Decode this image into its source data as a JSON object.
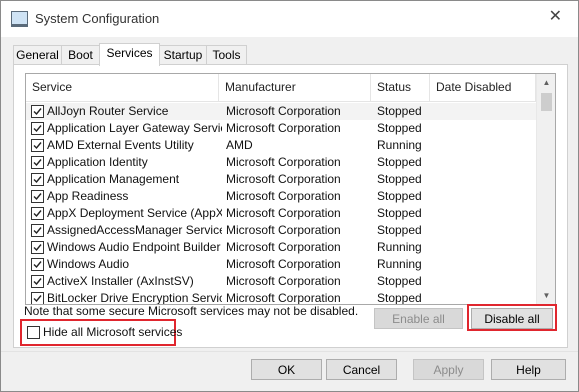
{
  "window": {
    "title": "System Configuration",
    "close_icon": "close-icon"
  },
  "tabs": [
    {
      "label": "General",
      "active": false
    },
    {
      "label": "Boot",
      "active": false
    },
    {
      "label": "Services",
      "active": true
    },
    {
      "label": "Startup",
      "active": false
    },
    {
      "label": "Tools",
      "active": false
    }
  ],
  "columns": [
    "Service",
    "Manufacturer",
    "Status",
    "Date Disabled"
  ],
  "services": [
    {
      "name": "AllJoyn Router Service",
      "manufacturer": "Microsoft Corporation",
      "status": "Stopped",
      "date_disabled": "",
      "checked": true,
      "selected": true
    },
    {
      "name": "Application Layer Gateway Service",
      "manufacturer": "Microsoft Corporation",
      "status": "Stopped",
      "date_disabled": "",
      "checked": true
    },
    {
      "name": "AMD External Events Utility",
      "manufacturer": "AMD",
      "status": "Running",
      "date_disabled": "",
      "checked": true
    },
    {
      "name": "Application Identity",
      "manufacturer": "Microsoft Corporation",
      "status": "Stopped",
      "date_disabled": "",
      "checked": true
    },
    {
      "name": "Application Management",
      "manufacturer": "Microsoft Corporation",
      "status": "Stopped",
      "date_disabled": "",
      "checked": true
    },
    {
      "name": "App Readiness",
      "manufacturer": "Microsoft Corporation",
      "status": "Stopped",
      "date_disabled": "",
      "checked": true
    },
    {
      "name": "AppX Deployment Service (AppX...",
      "manufacturer": "Microsoft Corporation",
      "status": "Stopped",
      "date_disabled": "",
      "checked": true
    },
    {
      "name": "AssignedAccessManager Service",
      "manufacturer": "Microsoft Corporation",
      "status": "Stopped",
      "date_disabled": "",
      "checked": true
    },
    {
      "name": "Windows Audio Endpoint Builder",
      "manufacturer": "Microsoft Corporation",
      "status": "Running",
      "date_disabled": "",
      "checked": true
    },
    {
      "name": "Windows Audio",
      "manufacturer": "Microsoft Corporation",
      "status": "Running",
      "date_disabled": "",
      "checked": true
    },
    {
      "name": "ActiveX Installer (AxInstSV)",
      "manufacturer": "Microsoft Corporation",
      "status": "Stopped",
      "date_disabled": "",
      "checked": true
    },
    {
      "name": "BitLocker Drive Encryption Service",
      "manufacturer": "Microsoft Corporation",
      "status": "Stopped",
      "date_disabled": "",
      "checked": true
    }
  ],
  "note": "Note that some secure Microsoft services may not be disabled.",
  "buttons": {
    "enable_all": "Enable all",
    "disable_all": "Disable all",
    "ok": "OK",
    "cancel": "Cancel",
    "apply": "Apply",
    "help": "Help"
  },
  "hide_ms": {
    "label": "Hide all Microsoft services",
    "checked": false
  },
  "colors": {
    "highlight": "#e0262e",
    "selected_row": "#f3f3f3"
  }
}
